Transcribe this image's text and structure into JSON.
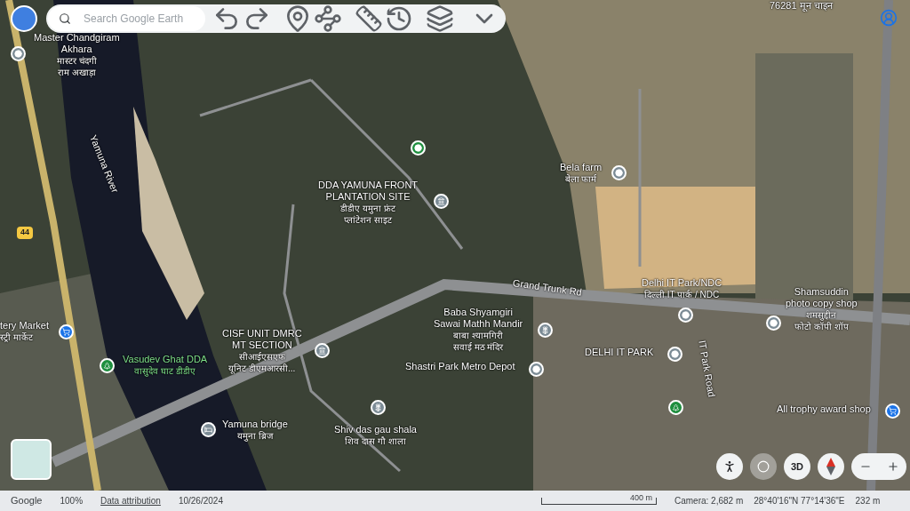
{
  "toolbar": {
    "search": {
      "placeholder": "Search Google Earth"
    }
  },
  "map": {
    "labels": [
      {
        "lines": [
          "76281 मून चाइन"
        ],
        "kind": "place"
      },
      {
        "lines": [
          "Master Chandgiram",
          "Akhara",
          "मास्टर चंदगी",
          "राम अखाड़ा"
        ],
        "kind": "place"
      },
      {
        "lines": [
          "Yamuna River"
        ],
        "kind": "place"
      },
      {
        "lines": [
          "Bela farm",
          "बेला फार्म"
        ],
        "kind": "place"
      },
      {
        "lines": [
          "DDA YAMUNA FRONT",
          "PLANTATION SITE",
          "डीडीए यमुना फ्रंट",
          "प्लांटेशन साइट"
        ],
        "kind": "place"
      },
      {
        "lines": [
          "Grand Trunk Rd"
        ],
        "kind": "place"
      },
      {
        "lines": [
          "Delhi IT Park/NDC",
          "दिल्ली IT पार्क / NDC"
        ],
        "kind": "place"
      },
      {
        "lines": [
          "Shamsuddin",
          "photo copy shop",
          "शमसुद्दीन",
          "फोटो कॉपी शॉप"
        ],
        "kind": "place"
      },
      {
        "lines": [
          "tery Market",
          "स्ट्री मार्केट"
        ],
        "kind": "place"
      },
      {
        "lines": [
          "Baba Shyamgiri",
          "Sawai Mathh Mandir",
          "बाबा श्यामगिरी",
          "सवाई मठ मंदिर"
        ],
        "kind": "place"
      },
      {
        "lines": [
          "CISF UNIT DMRC",
          "MT SECTION",
          "सीआईएसएफ",
          "यूनिट डीएमआरसी..."
        ],
        "kind": "place"
      },
      {
        "lines": [
          "IT Park Road"
        ],
        "kind": "place"
      },
      {
        "lines": [
          "DELHI IT PARK"
        ],
        "kind": "place"
      },
      {
        "lines": [
          "Vasudev Ghat DDA",
          "वासुदेव घाट डीडीए"
        ],
        "kind": "park"
      },
      {
        "lines": [
          "Shastri Park Metro Depot"
        ],
        "kind": "place"
      },
      {
        "lines": [
          "All trophy award shop"
        ],
        "kind": "place"
      },
      {
        "lines": [
          "Yamuna bridge",
          "यमुना ब्रिज"
        ],
        "kind": "place"
      },
      {
        "lines": [
          "Shiv das gau shala",
          "शिव दास गौ शाला"
        ],
        "kind": "place"
      }
    ],
    "pins": [
      {
        "kind": "place",
        "color": "#7b8b95"
      },
      {
        "kind": "museum",
        "color": "#7b8b95"
      },
      {
        "kind": "place",
        "color": "#7b8b95"
      },
      {
        "kind": "place",
        "color": "#7b8b95"
      },
      {
        "kind": "place",
        "color": "#7b8b95"
      },
      {
        "kind": "shop",
        "color": "#1a73e8"
      },
      {
        "kind": "park",
        "color": "#1e8e3e"
      },
      {
        "kind": "museum",
        "color": "#7b8b95"
      },
      {
        "kind": "temple",
        "color": "#7b8b95"
      },
      {
        "kind": "place",
        "color": "#7b8b95"
      },
      {
        "kind": "place",
        "color": "#7b8b95"
      },
      {
        "kind": "hotel",
        "color": "#7b8b95"
      },
      {
        "kind": "temple",
        "color": "#7b8b95"
      },
      {
        "kind": "shop",
        "color": "#1a73e8"
      },
      {
        "kind": "place",
        "color": "#1e8e3e"
      },
      {
        "kind": "park",
        "color": "#1e8e3e"
      }
    ],
    "road_shield": "44",
    "controls": {
      "three_d": "3D"
    }
  },
  "status_bar": {
    "brand": "Google",
    "zoom": "100%",
    "attribution": "Data attribution",
    "date": "10/26/2024",
    "scale": "400 m",
    "camera": "Camera: 2,682 m",
    "coordinates": "28°40'16\"N 77°14'36\"E",
    "elevation": "232 m"
  }
}
